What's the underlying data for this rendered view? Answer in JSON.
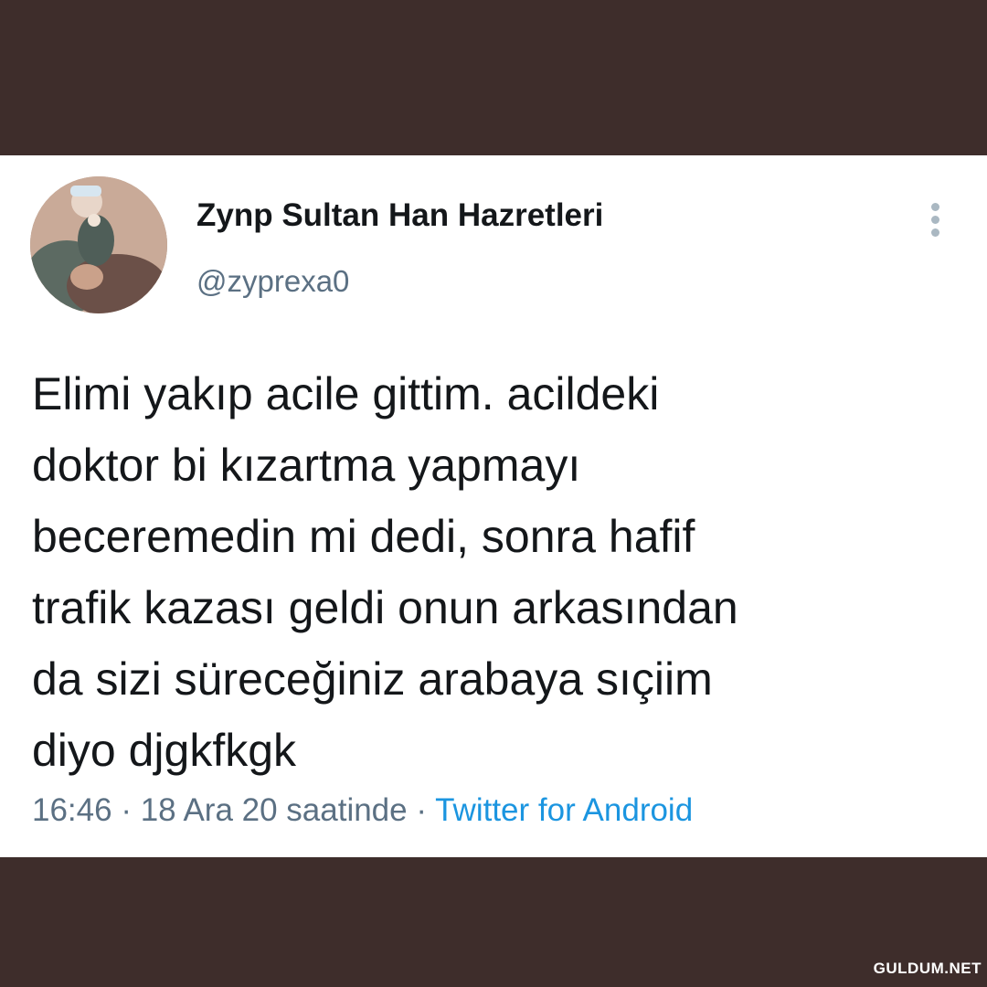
{
  "tweet": {
    "display_name": "Zynp Sultan Han Hazretleri",
    "handle": "@zyprexa0",
    "text_lines": [
      "Elimi yakıp acile gittim. acildeki",
      "doktor bi kızartma yapmayı",
      "beceremedin mi dedi, sonra hafif",
      "trafik kazası geldi onun arkasından",
      "da sizi süreceğiniz arabaya sıçiim",
      "diyo djgkfkgk"
    ],
    "time": "16:46",
    "separator": "·",
    "date": "18 Ara 20 saatinde",
    "source": "Twitter for Android"
  },
  "watermark": "GULDUM.NET",
  "colors": {
    "background": "#3e2d2b",
    "card": "#ffffff",
    "text": "#14171a",
    "muted": "#5b7083",
    "link": "#1b95e0"
  },
  "icons": {
    "more": "more-vertical-icon",
    "avatar": "avatar"
  }
}
